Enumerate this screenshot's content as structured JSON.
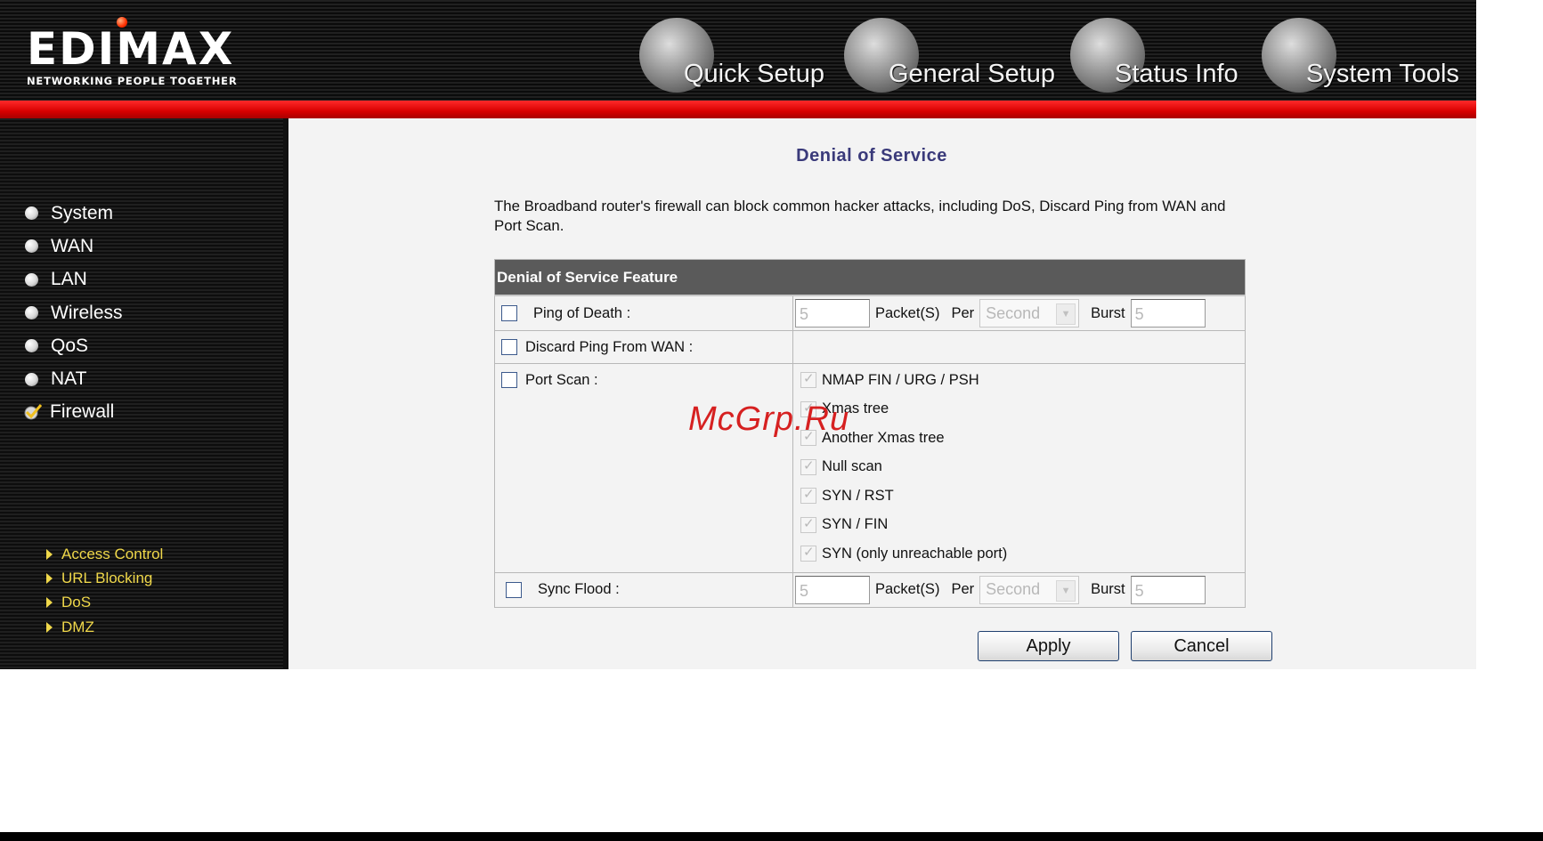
{
  "brand": {
    "name": "EDIMAX",
    "tagline": "NETWORKING PEOPLE TOGETHER"
  },
  "top_nav": [
    {
      "label": "Quick Setup",
      "icon": "quick-setup-icon"
    },
    {
      "label": "General Setup",
      "icon": "general-setup-icon"
    },
    {
      "label": "Status Info",
      "icon": "status-info-icon"
    },
    {
      "label": "System Tools",
      "icon": "system-tools-icon"
    }
  ],
  "sidebar": {
    "items": [
      {
        "label": "System"
      },
      {
        "label": "WAN"
      },
      {
        "label": "LAN"
      },
      {
        "label": "Wireless"
      },
      {
        "label": "QoS"
      },
      {
        "label": "NAT"
      },
      {
        "label": "Firewall",
        "active": true
      }
    ],
    "sub_items": [
      {
        "label": "Access Control"
      },
      {
        "label": "URL Blocking"
      },
      {
        "label": "DoS",
        "active": true
      },
      {
        "label": "DMZ"
      }
    ]
  },
  "page": {
    "title": "Denial of Service",
    "description": "The Broadband router's firewall can block common hacker attacks, including DoS, Discard Ping from WAN and Port Scan.",
    "table_header": "Denial of Service Feature",
    "ping_of_death": {
      "label": "Ping of Death :",
      "packets": "5",
      "packets_label": "Packet(S)",
      "per_label": "Per",
      "per_value": "Second",
      "burst_label": "Burst",
      "burst": "5",
      "checked": false
    },
    "discard_ping": {
      "label": "Discard Ping From WAN :",
      "checked": false
    },
    "port_scan": {
      "label": "Port Scan :",
      "checked": false,
      "options": [
        "NMAP FIN / URG / PSH",
        "Xmas tree",
        "Another Xmas tree",
        "Null scan",
        "SYN / RST",
        "SYN / FIN",
        "SYN (only unreachable port)"
      ]
    },
    "sync_flood": {
      "label": "Sync Flood :",
      "packets": "5",
      "packets_label": "Packet(S)",
      "per_label": "Per",
      "per_value": "Second",
      "burst_label": "Burst",
      "burst": "5",
      "checked": false
    },
    "buttons": {
      "apply": "Apply",
      "cancel": "Cancel"
    }
  },
  "watermark": "McGrp.Ru",
  "colors": {
    "accent_red": "#e00000",
    "title_blue": "#3a3a7a",
    "submenu_yellow": "#f0d84a",
    "table_header": "#5a5a5a"
  }
}
